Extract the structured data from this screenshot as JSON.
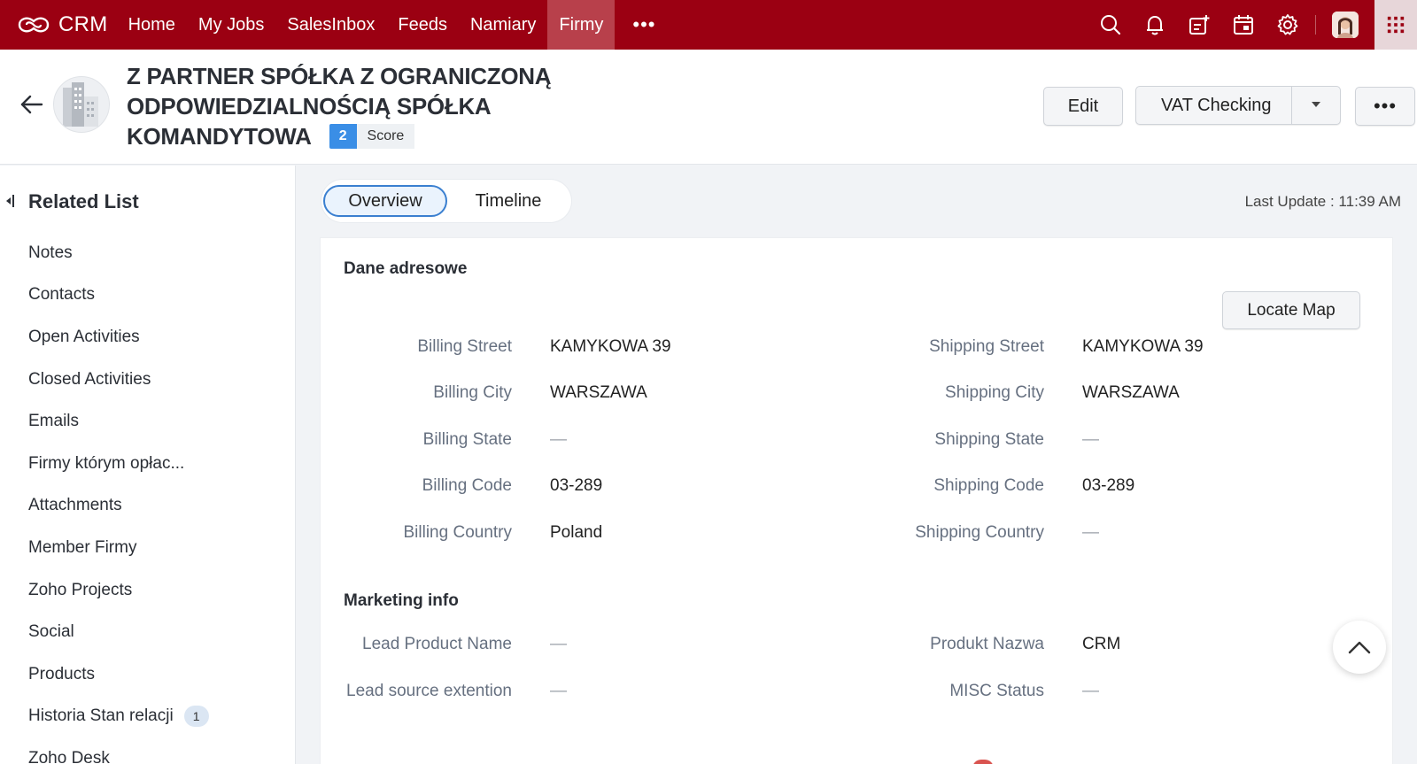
{
  "nav": {
    "logo_text": "CRM",
    "items": [
      {
        "label": "Home"
      },
      {
        "label": "My Jobs"
      },
      {
        "label": "SalesInbox"
      },
      {
        "label": "Feeds"
      },
      {
        "label": "Namiary"
      },
      {
        "label": "Firmy",
        "active": true
      }
    ],
    "more": "•••",
    "icons": [
      "search-icon",
      "bell-icon",
      "add-task-icon",
      "calendar-icon",
      "gear-icon",
      "avatar",
      "apps-grid-icon"
    ],
    "accent": "#9b0012"
  },
  "header": {
    "title_lines": [
      "Z PARTNER SPÓŁKA Z OGRANICZONĄ",
      "ODPOWIEDZIALNOŚCIĄ SPÓŁKA",
      "KOMANDYTOWA"
    ],
    "score_value": "2",
    "score_label": "Score",
    "edit_label": "Edit",
    "vat_label": "VAT Checking",
    "more_label": "•••"
  },
  "sidebar": {
    "title": "Related List",
    "items": [
      {
        "label": "Notes"
      },
      {
        "label": "Contacts"
      },
      {
        "label": "Open Activities"
      },
      {
        "label": "Closed Activities"
      },
      {
        "label": "Emails"
      },
      {
        "label": "Firmy którym opłac..."
      },
      {
        "label": "Attachments"
      },
      {
        "label": "Member Firmy"
      },
      {
        "label": "Zoho Projects"
      },
      {
        "label": "Social"
      },
      {
        "label": "Products"
      },
      {
        "label": "Historia Stan relacji",
        "badge": "1"
      },
      {
        "label": "Zoho Desk"
      }
    ]
  },
  "tabs": {
    "overview": "Overview",
    "timeline": "Timeline",
    "last_update": "Last Update : 11:39 AM"
  },
  "address": {
    "title": "Dane adresowe",
    "locate_map": "Locate Map",
    "billing": [
      {
        "label": "Billing Street",
        "value": "KAMYKOWA 39"
      },
      {
        "label": "Billing City",
        "value": "WARSZAWA"
      },
      {
        "label": "Billing State",
        "value": "—"
      },
      {
        "label": "Billing Code",
        "value": "03-289"
      },
      {
        "label": "Billing Country",
        "value": "Poland"
      }
    ],
    "shipping": [
      {
        "label": "Shipping Street",
        "value": "KAMYKOWA 39"
      },
      {
        "label": "Shipping City",
        "value": "WARSZAWA"
      },
      {
        "label": "Shipping State",
        "value": "—"
      },
      {
        "label": "Shipping Code",
        "value": "03-289"
      },
      {
        "label": "Shipping Country",
        "value": "—"
      }
    ]
  },
  "marketing": {
    "title": "Marketing info",
    "left": [
      {
        "label": "Lead Product Name",
        "value": "—"
      },
      {
        "label": "Lead source extention",
        "value": "—"
      }
    ],
    "right": [
      {
        "label": "Produkt Nazwa",
        "value": "CRM"
      },
      {
        "label": "MISC Status",
        "value": "—"
      }
    ]
  }
}
